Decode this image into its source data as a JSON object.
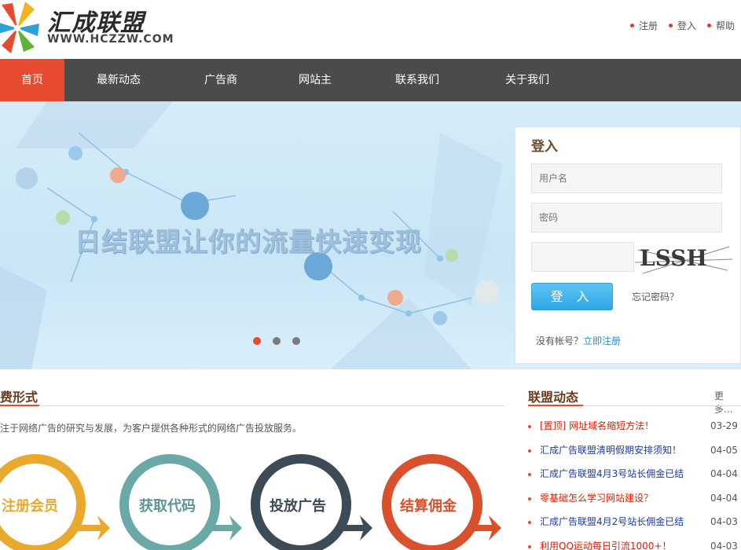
{
  "header": {
    "logo_title": "汇成联盟",
    "logo_url_text": "WWW.HCZZW.COM",
    "links": [
      "注册",
      "登入",
      "帮助"
    ]
  },
  "nav": {
    "items": [
      "首页",
      "最新动态",
      "广告商",
      "网站主",
      "联系我们",
      "关于我们"
    ],
    "active_index": 0
  },
  "banner": {
    "slogan": "日结联盟让你的流量快速变现",
    "slide_count": 3,
    "active_slide": 0
  },
  "login": {
    "title": "登入",
    "username_placeholder": "用户名",
    "password_placeholder": "密码",
    "code_value": "",
    "captcha_text": "LSSH",
    "submit_label": "登 入",
    "forgot_label": "忘记密码？",
    "no_account_text": "没有帐号？",
    "register_link": "立即注册"
  },
  "fees": {
    "title": "费形式",
    "intro": "注于网络广告的研究与发展，为客户提供各种形式的网络广告投放服务。",
    "steps": [
      "注册会员",
      "获取代码",
      "投放广告",
      "结算佣金"
    ]
  },
  "news": {
    "title": "联盟动态",
    "more": "更多...",
    "items": [
      {
        "title": "[置顶] 网址域名缩短方法！",
        "date": "03-29",
        "hot": true
      },
      {
        "title": "汇成广告联盟清明假期安排须知！",
        "date": "04-05",
        "hot": false
      },
      {
        "title": "汇成广告联盟4月3号站长佣金已结",
        "date": "04-04",
        "hot": false
      },
      {
        "title": "零基础怎么学习网站建设？",
        "date": "04-04",
        "hot": true
      },
      {
        "title": "汇成广告联盟4月2号站长佣金已结",
        "date": "04-03",
        "hot": false
      },
      {
        "title": "利用QQ运动每日引流1000+！",
        "date": "04-03",
        "hot": true
      }
    ]
  },
  "colors": {
    "accent": "#e84a2f",
    "nav_bg": "#4b4b4b",
    "login_button": "#2fa6e6",
    "circle_1": "#e8a92c",
    "circle_2": "#6aa9a8",
    "circle_3": "#3d4b57",
    "circle_4": "#d9502c"
  }
}
